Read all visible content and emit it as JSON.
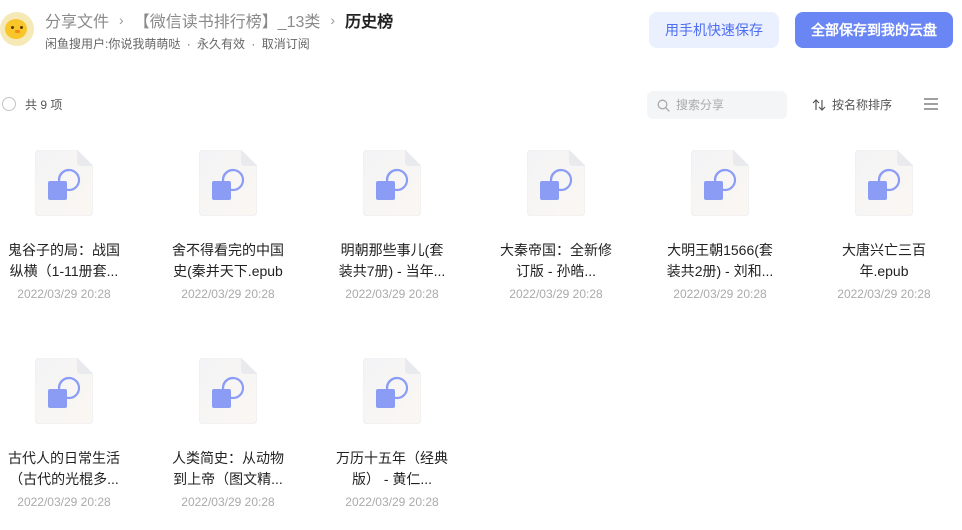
{
  "header": {
    "breadcrumb": [
      "分享文件",
      "【微信读书排行榜】_13类",
      "历史榜"
    ],
    "sub_info": {
      "owner": "闲鱼搜用户:你说我萌萌哒",
      "validity": "永久有效",
      "cancel": "取消订阅"
    },
    "buttons": {
      "mobile_save": "用手机快速保存",
      "save_all": "全部保存到我的云盘"
    }
  },
  "toolbar": {
    "count": "共 9 项",
    "search_placeholder": "搜索分享",
    "sort_label": "按名称排序"
  },
  "files": [
    {
      "name": "鬼谷子的局：战国纵横（1-11册套...",
      "date": "2022/03/29 20:28"
    },
    {
      "name": "舍不得看完的中国史(秦并天下.epub",
      "date": "2022/03/29 20:28"
    },
    {
      "name": "明朝那些事儿(套装共7册) - 当年...",
      "date": "2022/03/29 20:28"
    },
    {
      "name": "大秦帝国：全新修订版 - 孙皓...",
      "date": "2022/03/29 20:28"
    },
    {
      "name": "大明王朝1566(套装共2册) - 刘和...",
      "date": "2022/03/29 20:28"
    },
    {
      "name": "大唐兴亡三百年.epub",
      "date": "2022/03/29 20:28"
    },
    {
      "name": "古代人的日常生活（古代的光棍多...",
      "date": "2022/03/29 20:28"
    },
    {
      "name": "人类简史：从动物到上帝（图文精...",
      "date": "2022/03/29 20:28"
    },
    {
      "name": "万历十五年（经典版） - 黄仁...",
      "date": "2022/03/29 20:28"
    }
  ],
  "colors": {
    "accent": "#4e6ef2",
    "primary_button": "#6a86f5",
    "light_button": "#eaf0fe",
    "file_icon_fill": "#8b9cf5"
  },
  "icons": {
    "avatar": "chick-avatar",
    "file": "epub-file-icon",
    "search": "search-icon",
    "sort": "sort-icon",
    "menu": "list-menu-icon"
  }
}
